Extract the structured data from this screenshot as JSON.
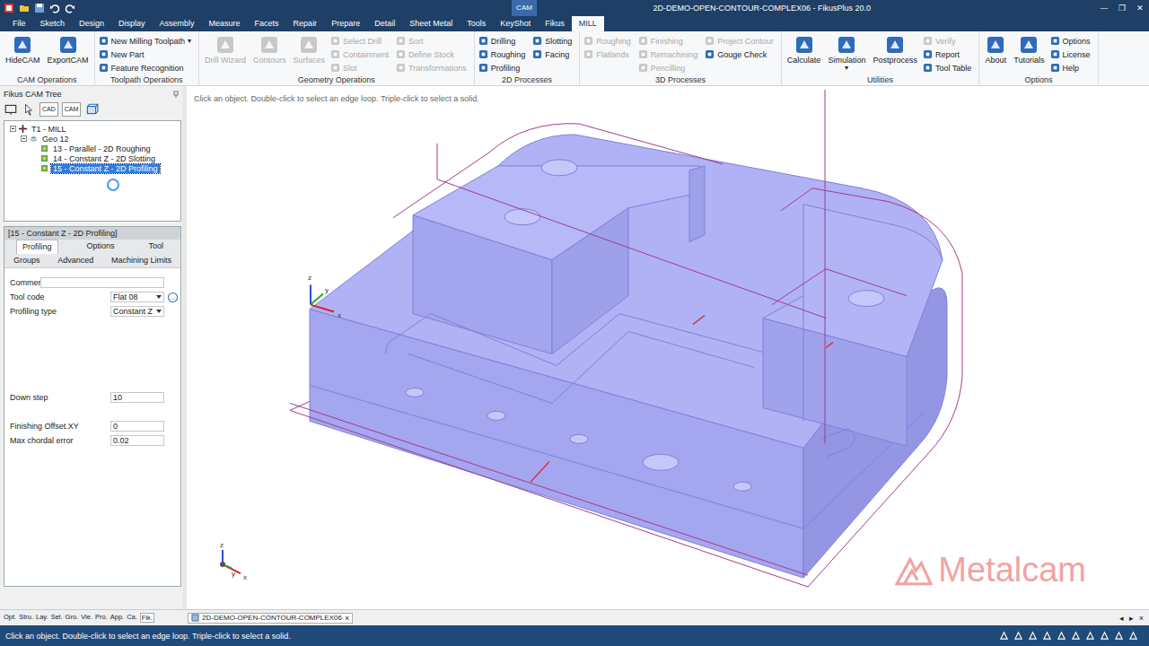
{
  "window": {
    "title": "2D-DEMO-OPEN-CONTOUR-COMPLEX06 - FikusPlus 20.0",
    "context_label": "CAM",
    "controls": [
      "—",
      "❐",
      "✕"
    ]
  },
  "menu_tabs": [
    {
      "label": "File",
      "selected": false
    },
    {
      "label": "Sketch",
      "selected": false
    },
    {
      "label": "Design",
      "selected": false
    },
    {
      "label": "Display",
      "selected": false
    },
    {
      "label": "Assembly",
      "selected": false
    },
    {
      "label": "Measure",
      "selected": false
    },
    {
      "label": "Facets",
      "selected": false
    },
    {
      "label": "Repair",
      "selected": false
    },
    {
      "label": "Prepare",
      "selected": false
    },
    {
      "label": "Detail",
      "selected": false
    },
    {
      "label": "Sheet Metal",
      "selected": false
    },
    {
      "label": "Tools",
      "selected": false
    },
    {
      "label": "KeyShot",
      "selected": false
    },
    {
      "label": "Fikus",
      "selected": false
    },
    {
      "label": "MILL",
      "selected": true
    }
  ],
  "ribbon": {
    "groups": [
      {
        "label": "CAM Operations",
        "columns": [
          [
            {
              "label": "HideCAM",
              "kind": "large",
              "disabled": false
            }
          ],
          [
            {
              "label": "ExportCAM",
              "kind": "large",
              "disabled": false
            }
          ]
        ]
      },
      {
        "label": "Toolpath Operations",
        "columns": [
          [
            {
              "label": "New Milling Toolpath",
              "kind": "small",
              "disabled": false,
              "caret": "▾"
            },
            {
              "label": "New Part",
              "kind": "small",
              "disabled": false
            },
            {
              "label": "Feature Recognition",
              "kind": "small",
              "disabled": false
            }
          ]
        ]
      },
      {
        "label": "Geometry Operations",
        "columns": [
          [
            {
              "label": "Drill Wizard",
              "kind": "large",
              "disabled": true
            }
          ],
          [
            {
              "label": "Contours",
              "kind": "large",
              "disabled": true
            }
          ],
          [
            {
              "label": "Surfaces",
              "kind": "large",
              "disabled": true
            }
          ],
          [
            {
              "label": "Select Drill",
              "kind": "small",
              "disabled": true
            },
            {
              "label": "Containment",
              "kind": "small",
              "disabled": true
            },
            {
              "label": "Slot",
              "kind": "small",
              "disabled": true
            }
          ],
          [
            {
              "label": "Sort",
              "kind": "small",
              "disabled": true
            },
            {
              "label": "Define Stock",
              "kind": "small",
              "disabled": true
            },
            {
              "label": "Transformations",
              "kind": "small",
              "disabled": true
            }
          ]
        ]
      },
      {
        "label": "2D Processes",
        "columns": [
          [
            {
              "label": "Drilling",
              "kind": "small",
              "disabled": false
            },
            {
              "label": "Roughing",
              "kind": "small",
              "disabled": false
            },
            {
              "label": "Profiling",
              "kind": "small",
              "disabled": false
            }
          ],
          [
            {
              "label": "Slotting",
              "kind": "small",
              "disabled": false
            },
            {
              "label": "Facing",
              "kind": "small",
              "disabled": false
            }
          ]
        ]
      },
      {
        "label": "3D Processes",
        "columns": [
          [
            {
              "label": "Roughing",
              "kind": "small",
              "disabled": true
            },
            {
              "label": "Flatlands",
              "kind": "small",
              "disabled": true
            }
          ],
          [
            {
              "label": "Finishing",
              "kind": "small",
              "disabled": true
            },
            {
              "label": "Remachining",
              "kind": "small",
              "disabled": true
            },
            {
              "label": "Pencilling",
              "kind": "small",
              "disabled": true
            }
          ],
          [
            {
              "label": "Project Contour",
              "kind": "small",
              "disabled": true
            },
            {
              "label": "Gouge Check",
              "kind": "small",
              "disabled": false
            }
          ]
        ]
      },
      {
        "label": "Utilities",
        "columns": [
          [
            {
              "label": "Calculate",
              "kind": "large",
              "disabled": false
            }
          ],
          [
            {
              "label": "Simulation",
              "kind": "large",
              "disabled": false,
              "caret": "▾"
            }
          ],
          [
            {
              "label": "Postprocess",
              "kind": "large",
              "disabled": false
            }
          ],
          [
            {
              "label": "Verify",
              "kind": "small",
              "disabled": true
            },
            {
              "label": "Report",
              "kind": "small",
              "disabled": false
            },
            {
              "label": "Tool Table",
              "kind": "small",
              "disabled": false
            }
          ]
        ]
      },
      {
        "label": "Options",
        "columns": [
          [
            {
              "label": "About",
              "kind": "large",
              "disabled": false
            }
          ],
          [
            {
              "label": "Tutorials",
              "kind": "large",
              "disabled": false
            }
          ],
          [
            {
              "label": "Options",
              "kind": "small",
              "disabled": false
            },
            {
              "label": "License",
              "kind": "small",
              "disabled": false
            },
            {
              "label": "Help",
              "kind": "small",
              "disabled": false
            }
          ]
        ]
      }
    ]
  },
  "cam_tree": {
    "title": "Fikus CAM Tree",
    "busy": true,
    "toolbar": [
      {
        "kind": "monitor"
      },
      {
        "kind": "cursor"
      },
      {
        "kind": "text",
        "label": "CAD"
      },
      {
        "kind": "text",
        "label": "CAM"
      },
      {
        "kind": "cube"
      }
    ],
    "items": [
      {
        "label": "T1 - MILL",
        "depth": 0,
        "kind": "tool",
        "has_children": true,
        "expanded": true,
        "selected": false
      },
      {
        "label": "Geo 12",
        "depth": 1,
        "kind": "geo",
        "has_children": true,
        "expanded": true,
        "selected": false
      },
      {
        "label": "13 - Parallel - 2D Roughing",
        "depth": 2,
        "kind": "op",
        "has_children": false,
        "expanded": false,
        "selected": false
      },
      {
        "label": "14 - Constant Z - 2D Slotting",
        "depth": 2,
        "kind": "op",
        "has_children": false,
        "expanded": false,
        "selected": false
      },
      {
        "label": "15 - Constant Z - 2D Profiling",
        "depth": 2,
        "kind": "op",
        "has_children": false,
        "expanded": false,
        "selected": true
      }
    ]
  },
  "properties": {
    "title": "[15 - Constant Z - 2D Profiling]",
    "tabs": [
      {
        "label": "Profiling",
        "selected": true
      },
      {
        "label": "Options",
        "selected": false
      },
      {
        "label": "Tool",
        "selected": false
      }
    ],
    "subtabs": [
      {
        "label": "Groups",
        "selected": false
      },
      {
        "label": "Advanced",
        "selected": false
      },
      {
        "label": "Machining Limits",
        "selected": false
      }
    ],
    "sections": [
      [
        {
          "label": "Comment",
          "value": "",
          "kind": "text"
        },
        {
          "label": "Tool code",
          "value": "Flat 08",
          "kind": "dropdown",
          "more": "..."
        },
        {
          "label": "Profiling type",
          "value": "Constant Z",
          "kind": "dropdown"
        }
      ],
      [
        {
          "label": "Down step",
          "value": "10",
          "kind": "text"
        }
      ],
      [
        {
          "label": "Finishing Offset.XY",
          "value": "0",
          "kind": "text"
        },
        {
          "label": "Max chordal error",
          "value": "0.02",
          "kind": "text"
        }
      ]
    ]
  },
  "viewport": {
    "hint": "Click an object. Double-click to select an edge loop. Triple-click to select a solid.",
    "axes": {
      "x": "x",
      "y": "y",
      "z": "z"
    },
    "watermark": "Metalcam"
  },
  "panel_tabs": [
    {
      "label": "Opt.",
      "selected": false
    },
    {
      "label": "Stru.",
      "selected": false
    },
    {
      "label": "Lay.",
      "selected": false
    },
    {
      "label": "Sel.",
      "selected": false
    },
    {
      "label": "Gro.",
      "selected": false
    },
    {
      "label": "Vie.",
      "selected": false
    },
    {
      "label": "Pro.",
      "selected": false
    },
    {
      "label": "App.",
      "selected": false
    },
    {
      "label": "Ca.",
      "selected": false
    },
    {
      "label": "Fik.",
      "selected": true
    }
  ],
  "document_tabs": [
    {
      "label": "2D-DEMO-OPEN-CONTOUR-COMPLEX06",
      "close": "×",
      "selected": true
    }
  ],
  "doc_nav": [
    "◂",
    "▸",
    "×"
  ],
  "status_bar": {
    "text": "Click an object. Double-click to select an edge loop. Triple-click to select a solid."
  }
}
